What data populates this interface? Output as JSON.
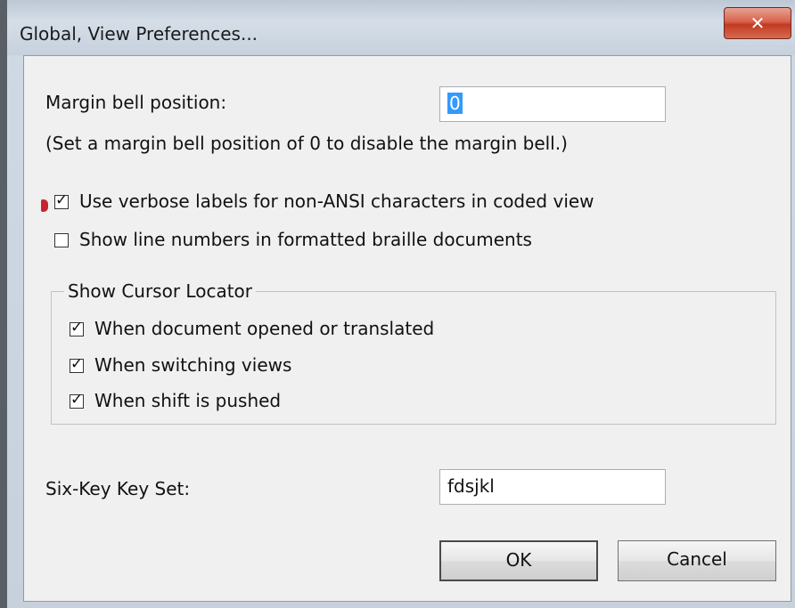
{
  "window": {
    "title": "Global, View Preferences...",
    "close_glyph": "✕"
  },
  "margin_bell": {
    "label": "Margin bell position:",
    "value": "0",
    "hint": "(Set a margin bell position of 0 to disable the margin bell.)"
  },
  "options": [
    {
      "label": "Use verbose labels for non-ANSI characters in coded view",
      "checked": true
    },
    {
      "label": "Show line numbers in formatted braille documents",
      "checked": false
    }
  ],
  "cursor_locator": {
    "title": "Show Cursor Locator",
    "items": [
      {
        "label": "When document opened or translated",
        "checked": true
      },
      {
        "label": "When switching views",
        "checked": true
      },
      {
        "label": "When shift is pushed",
        "checked": true
      }
    ]
  },
  "six_key": {
    "label": "Six-Key Key Set:",
    "value": "fdsjkl"
  },
  "buttons": {
    "ok": "OK",
    "cancel": "Cancel"
  },
  "colors": {
    "focus_marker": "#c8232c",
    "selection": "#3399ff"
  },
  "icons": {
    "close": "close-icon",
    "check": "check-mark-icon"
  }
}
